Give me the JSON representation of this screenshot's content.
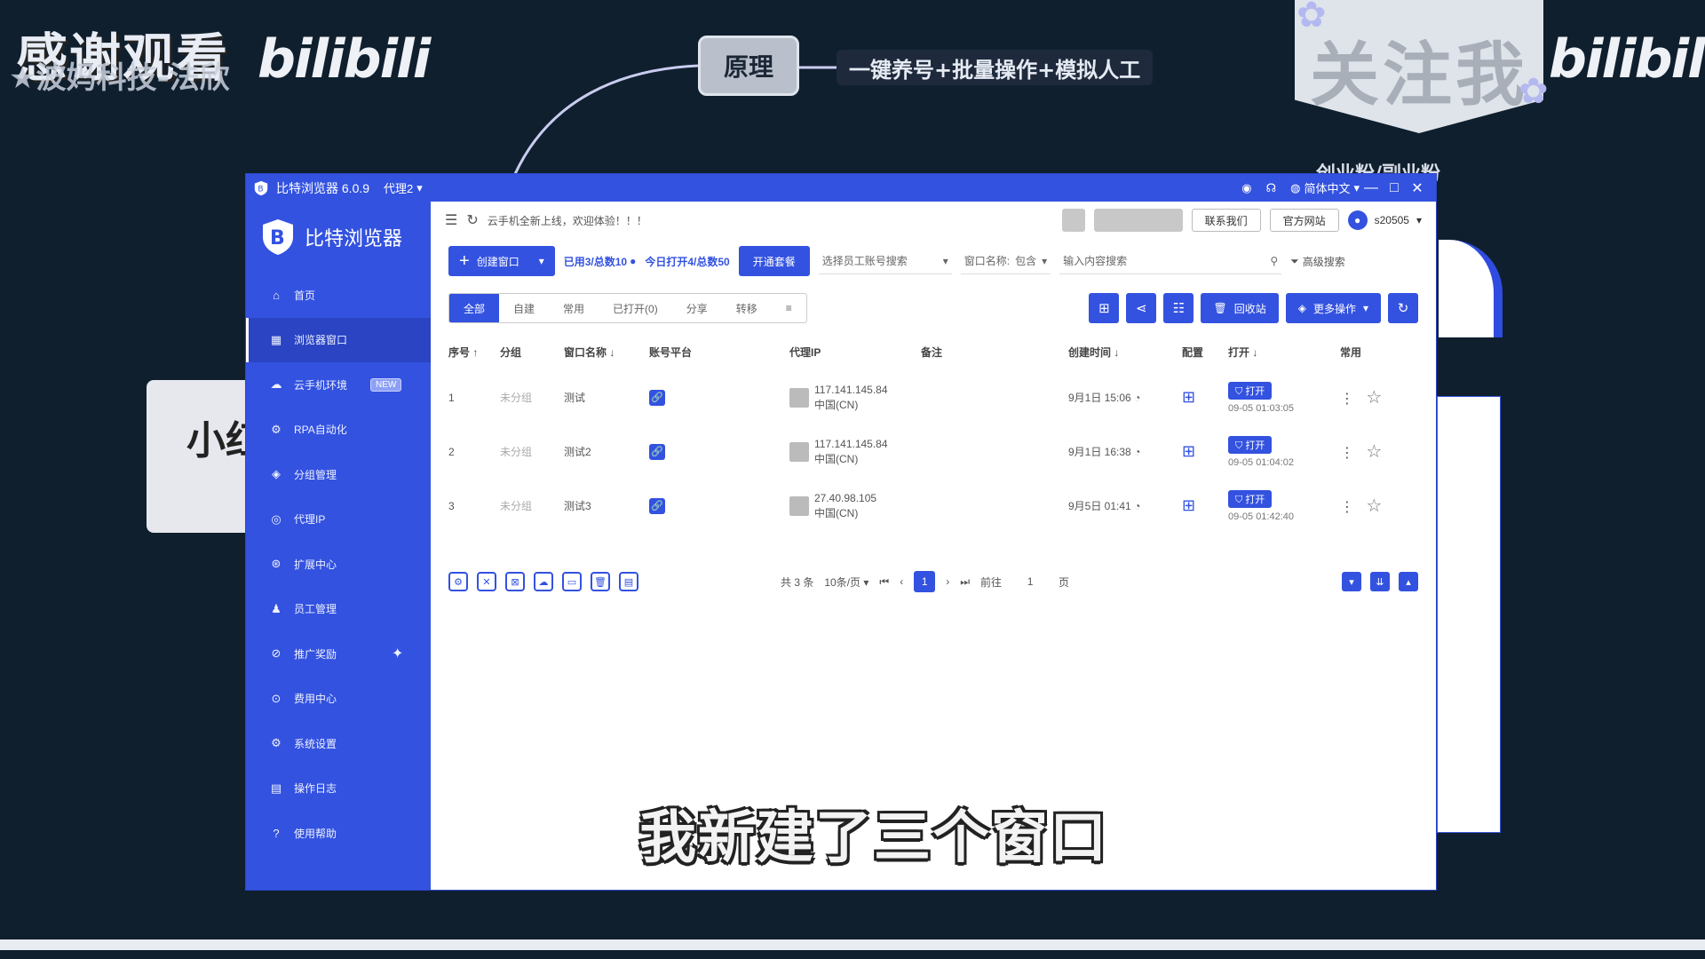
{
  "overlay": {
    "watermark_left_title": "感谢观看",
    "watermark_left_sub": "★波妈科技-法欣",
    "watermark_left_bili": "bilibili",
    "mindmap_node": "原理",
    "mindmap_desc": "一键养号+批量操作+模拟人工",
    "follow_badge": "关注我",
    "watermark_right_bili": "bilibili",
    "right_subtext": "创业粉/副业粉",
    "side_card_text": "小红",
    "subtitle": "我新建了三个窗口"
  },
  "window": {
    "title": "比特浏览器 6.0.9",
    "route": "代理2",
    "language": "简体中文",
    "minimize": "—",
    "maximize": "□",
    "close": "✕"
  },
  "sidebar": {
    "brand": "比特浏览器",
    "items": [
      {
        "label": "首页",
        "icon": "⌂"
      },
      {
        "label": "浏览器窗口",
        "icon": "▦"
      },
      {
        "label": "云手机环境",
        "icon": "☁",
        "badge": "NEW"
      },
      {
        "label": "RPA自动化",
        "icon": "⚙"
      },
      {
        "label": "分组管理",
        "icon": "◈"
      },
      {
        "label": "代理IP",
        "icon": "◎"
      },
      {
        "label": "扩展中心",
        "icon": "⊛"
      },
      {
        "label": "员工管理",
        "icon": "♟"
      },
      {
        "label": "推广奖励",
        "icon": "⊘"
      },
      {
        "label": "费用中心",
        "icon": "⊙"
      },
      {
        "label": "系统设置",
        "icon": "⚙"
      },
      {
        "label": "操作日志",
        "icon": "▤"
      },
      {
        "label": "使用帮助",
        "icon": "?"
      }
    ]
  },
  "topbar": {
    "notice": "云手机全新上线，欢迎体验！！！",
    "contact": "联系我们",
    "website": "官方网站",
    "username": "s20505"
  },
  "actionbar": {
    "create": "创建窗口",
    "used": "已用3/总数10",
    "opened_today": "今日打开4/总数50",
    "open_package": "开通套餐",
    "staff_placeholder": "选择员工账号搜索",
    "window_name_label": "窗口名称:",
    "match_mode": "包含",
    "search_placeholder": "输入内容搜索",
    "advanced_search": "高级搜索"
  },
  "tabs": [
    "全部",
    "自建",
    "常用",
    "已打开(0)",
    "分享",
    "转移"
  ],
  "toolbar_buttons": {
    "recycle": "回收站",
    "more": "更多操作"
  },
  "table": {
    "headers": [
      "序号",
      "分组",
      "窗口名称",
      "账号平台",
      "代理IP",
      "备注",
      "创建时间",
      "配置",
      "打开",
      "常用"
    ],
    "open_label": "打开",
    "rows": [
      {
        "no": "1",
        "group": "未分组",
        "name": "测试",
        "ip": "117.141.145.84",
        "region": "中国(CN)",
        "created": "9月1日 15:06",
        "opened": "09-05 01:03:05"
      },
      {
        "no": "2",
        "group": "未分组",
        "name": "测试2",
        "ip": "117.141.145.84",
        "region": "中国(CN)",
        "created": "9月1日 16:38",
        "opened": "09-05 01:04:02"
      },
      {
        "no": "3",
        "group": "未分组",
        "name": "测试3",
        "ip": "27.40.98.105",
        "region": "中国(CN)",
        "created": "9月5日 01:41",
        "opened": "09-05 01:42:40"
      }
    ]
  },
  "pagination": {
    "total": "共 3 条",
    "per_page": "10条/页",
    "current": "1",
    "goto_label": "前往",
    "goto_value": "1",
    "page_unit": "页"
  }
}
